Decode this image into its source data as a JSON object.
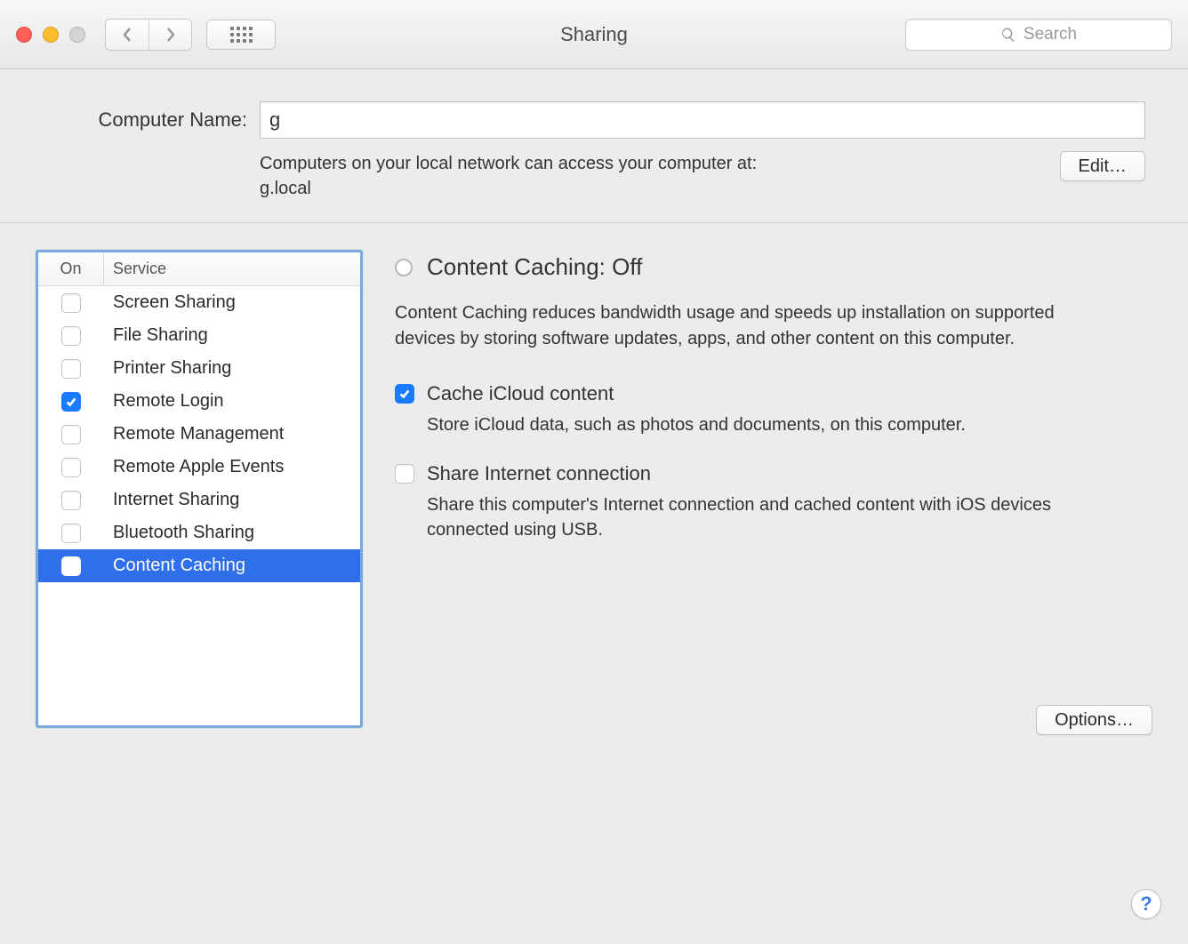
{
  "window": {
    "title": "Sharing",
    "search_placeholder": "Search"
  },
  "computer_name": {
    "label": "Computer Name:",
    "value": "g",
    "hint_line1": "Computers on your local network can access your computer at:",
    "hint_line2": "g.local",
    "edit_label": "Edit…"
  },
  "services": {
    "col_on": "On",
    "col_service": "Service",
    "items": [
      {
        "label": "Screen Sharing",
        "on": false,
        "selected": false
      },
      {
        "label": "File Sharing",
        "on": false,
        "selected": false
      },
      {
        "label": "Printer Sharing",
        "on": false,
        "selected": false
      },
      {
        "label": "Remote Login",
        "on": true,
        "selected": false
      },
      {
        "label": "Remote Management",
        "on": false,
        "selected": false
      },
      {
        "label": "Remote Apple Events",
        "on": false,
        "selected": false
      },
      {
        "label": "Internet Sharing",
        "on": false,
        "selected": false
      },
      {
        "label": "Bluetooth Sharing",
        "on": false,
        "selected": false
      },
      {
        "label": "Content Caching",
        "on": false,
        "selected": true
      }
    ]
  },
  "detail": {
    "status_title": "Content Caching: Off",
    "description": "Content Caching reduces bandwidth usage and speeds up installation on supported devices by storing software updates, apps, and other content on this computer.",
    "cache_icloud": {
      "checked": true,
      "label": "Cache iCloud content",
      "sub": "Store iCloud data, such as photos and documents, on this computer."
    },
    "share_internet": {
      "checked": false,
      "label": "Share Internet connection",
      "sub": "Share this computer's Internet connection and cached content with iOS devices connected using USB."
    },
    "options_label": "Options…"
  },
  "help_label": "?"
}
